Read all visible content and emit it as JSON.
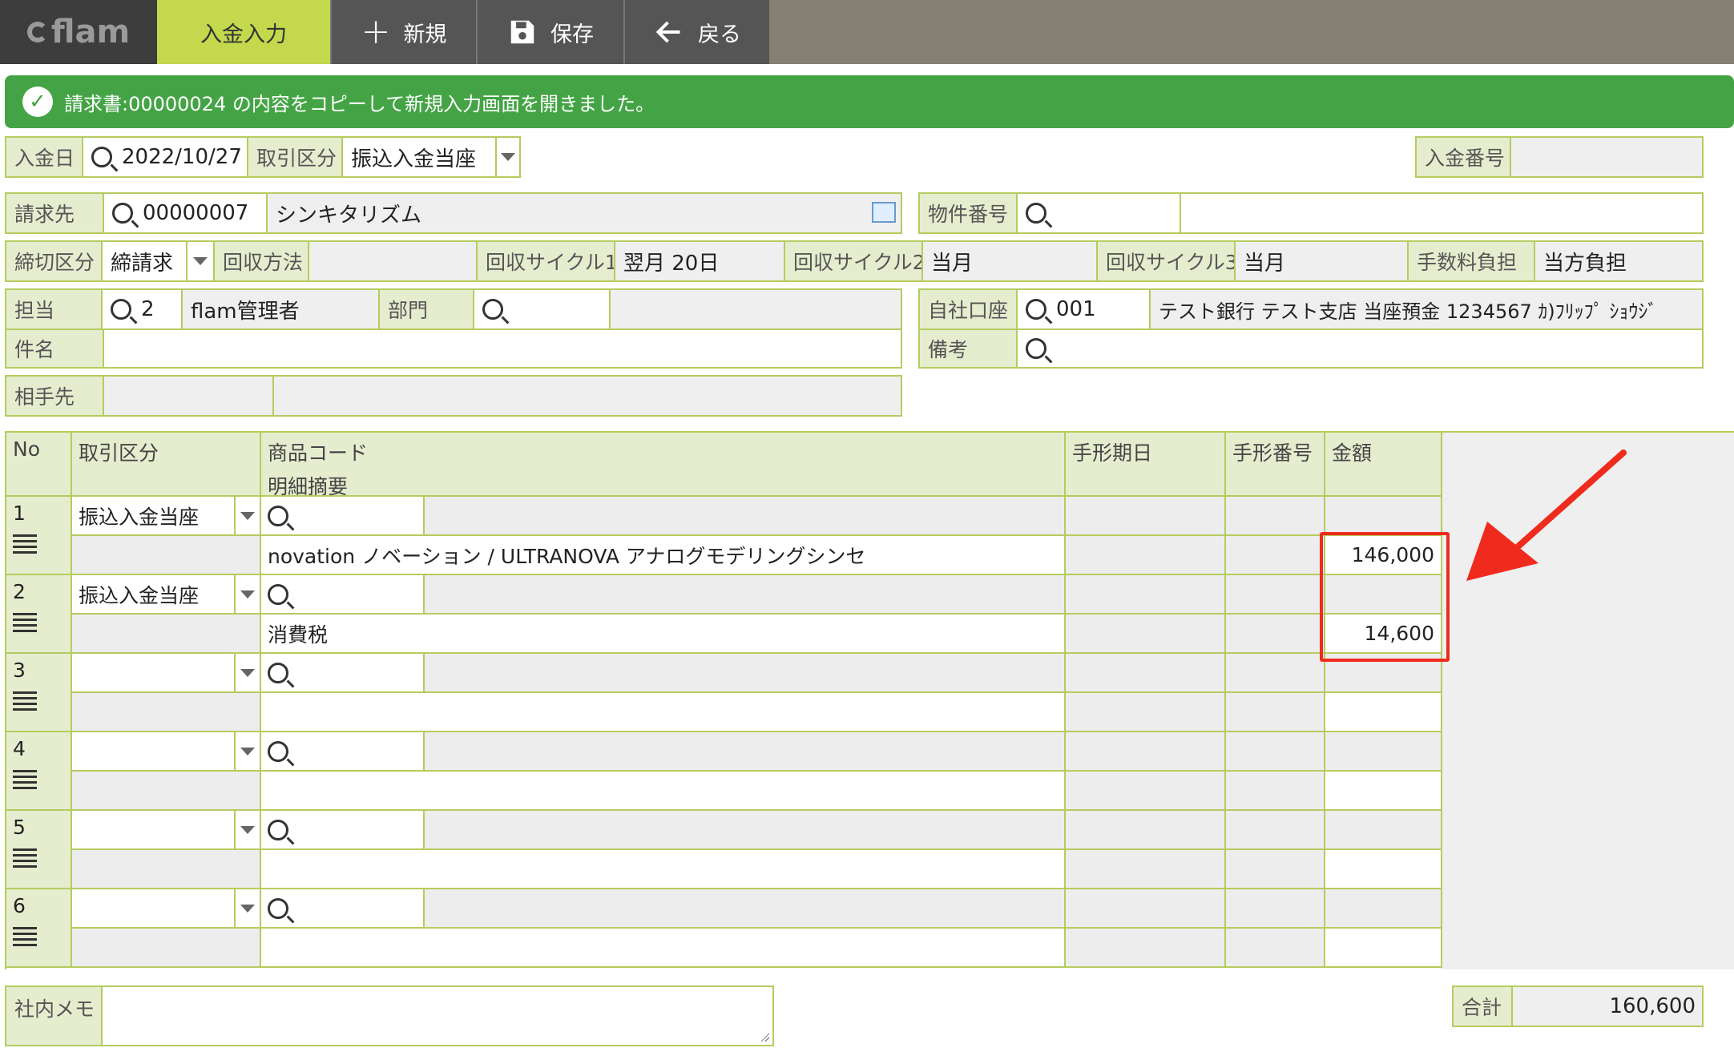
{
  "toolbar": {
    "logo": "flam",
    "tabs": [
      {
        "label": "入金入力",
        "active": true
      },
      {
        "label": "新規",
        "icon": "plus-icon"
      },
      {
        "label": "保存",
        "icon": "save-icon"
      },
      {
        "label": "戻る",
        "icon": "arrow-left-icon"
      }
    ]
  },
  "banner": {
    "message": "請求書:00000024 の内容をコピーして新規入力画面を開きました。",
    "color": "#44a445"
  },
  "header": {
    "payment_date_label": "入金日",
    "payment_date": "2022/10/27",
    "trade_type_label": "取引区分",
    "trade_type": "振込入金当座",
    "payment_no_label": "入金番号",
    "payment_no": "",
    "billing_label": "請求先",
    "billing_code": "00000007",
    "billing_name": "シンキタリズム",
    "property_label": "物件番号",
    "property_code": "",
    "property_name": "",
    "closing_label": "締切区分",
    "closing": "締請求",
    "collect_method_label": "回収方法",
    "collect_method": "",
    "cycle1_label": "回収サイクル1",
    "cycle1": "翌月 20日",
    "cycle2_label": "回収サイクル2",
    "cycle2": "当月",
    "cycle3_label": "回収サイクル3",
    "cycle3": "当月",
    "fee_label": "手数料負担",
    "fee": "当方負担",
    "staff_label": "担当",
    "staff_code": "2",
    "staff_name": "flam管理者",
    "dept_label": "部門",
    "dept_code": "",
    "dept_name": "",
    "own_account_label": "自社口座",
    "own_account_code": "001",
    "own_account_name": "テスト銀行 テスト支店 当座預金 1234567 ｶ)ﾌﾘｯﾌﾟ ｼｮｳｼﾞ",
    "subject_label": "件名",
    "subject": "",
    "remarks_label": "備考",
    "remarks": "",
    "counterparty_label": "相手先",
    "counterparty_code": "",
    "counterparty_name": ""
  },
  "grid": {
    "headers": {
      "no": "No",
      "trade": "取引区分",
      "code": "商品コード",
      "summary": "明細摘要",
      "due": "手形期日",
      "bill_no": "手形番号",
      "amount": "金額"
    },
    "rows": [
      {
        "no": "1",
        "trade": "振込入金当座",
        "summary": "novation ノベーション / ULTRANOVA アナログモデリングシンセ",
        "amount": "146,000"
      },
      {
        "no": "2",
        "trade": "振込入金当座",
        "summary": "消費税",
        "amount": "14,600"
      },
      {
        "no": "3",
        "trade": "",
        "summary": "",
        "amount": ""
      },
      {
        "no": "4",
        "trade": "",
        "summary": "",
        "amount": ""
      },
      {
        "no": "5",
        "trade": "",
        "summary": "",
        "amount": ""
      },
      {
        "no": "6",
        "trade": "",
        "summary": "",
        "amount": ""
      }
    ]
  },
  "footer": {
    "memo_label": "社内メモ",
    "memo": "",
    "total_label": "合計",
    "total": "160,600"
  },
  "colors": {
    "accent": "#c3d84c",
    "border": "#b5cc5e",
    "highlight": "#ee2b1c"
  }
}
